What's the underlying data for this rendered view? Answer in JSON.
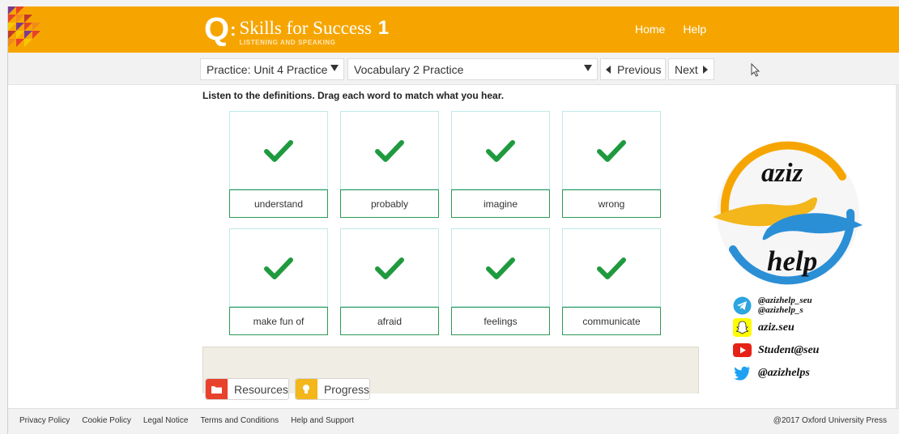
{
  "header": {
    "brand_q": "Q",
    "brand_title": "Skills for Success",
    "brand_level": "1",
    "brand_subtitle": "LISTENING AND SPEAKING",
    "nav": {
      "home": "Home",
      "help": "Help"
    }
  },
  "toolbar": {
    "unit_select": "Practice: Unit 4 Practice",
    "activity_select": "Vocabulary 2 Practice",
    "previous_label": "Previous",
    "next_label": "Next"
  },
  "activity": {
    "instruction": "Listen to the definitions. Drag each word to match what you hear.",
    "cards": [
      {
        "word": "understand",
        "status": "correct"
      },
      {
        "word": "probably",
        "status": "correct"
      },
      {
        "word": "imagine",
        "status": "correct"
      },
      {
        "word": "wrong",
        "status": "correct"
      },
      {
        "word": "make fun of",
        "status": "correct"
      },
      {
        "word": "afraid",
        "status": "correct"
      },
      {
        "word": "feelings",
        "status": "correct"
      },
      {
        "word": "communicate",
        "status": "correct"
      }
    ]
  },
  "bottom_panel": {
    "resources_label": "Resources",
    "progress_label": "Progress"
  },
  "watermark": {
    "word1": "aziz",
    "word2": "help",
    "telegram1": "@azizhelp_seu",
    "telegram2": "@azizhelp_s",
    "snapchat": "aziz.seu",
    "youtube": "Student@seu",
    "twitter": "@azizhelps"
  },
  "footer": {
    "links": [
      "Privacy Policy",
      "Cookie Policy",
      "Legal Notice",
      "Terms and Conditions",
      "Help and Support"
    ],
    "copyright": "@2017 Oxford University Press"
  },
  "colors": {
    "header_bg": "#f6a500",
    "check_green": "#1f9a3f",
    "card_border": "#2d9a56",
    "resources_icon": "#e8412c",
    "progress_icon": "#f3b61b"
  }
}
